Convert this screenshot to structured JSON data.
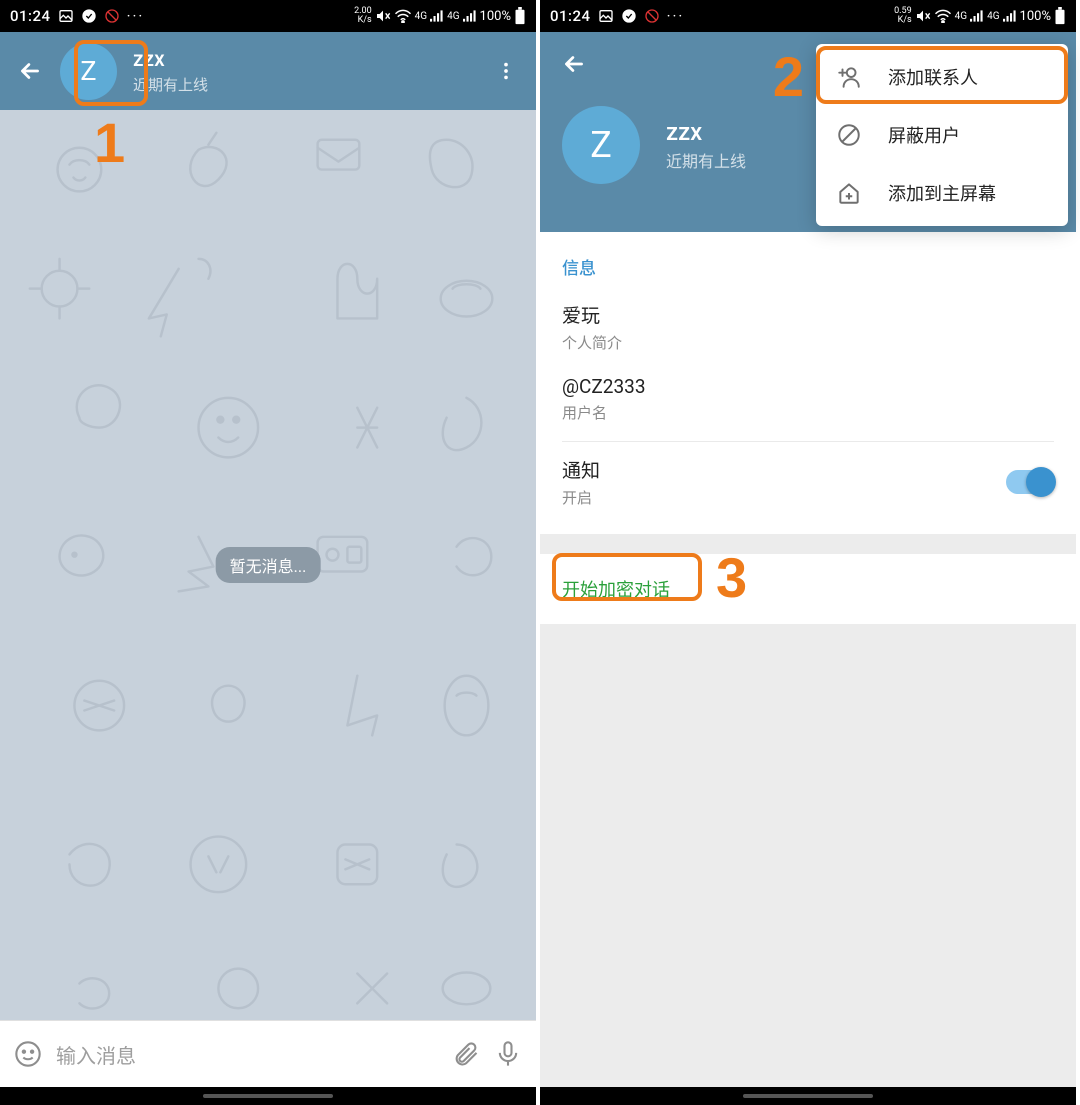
{
  "status": {
    "time": "01:24",
    "kbs_left": "2.00",
    "kbs_right": "0.59",
    "kbs_unit": "K/s",
    "net": "4G",
    "battery": "100%",
    "ellipsis": "···"
  },
  "left": {
    "contact": {
      "initial": "Z",
      "name": "zzx",
      "status": "近期有上线"
    },
    "empty_message": "暂无消息...",
    "input_placeholder": "输入消息"
  },
  "right": {
    "contact": {
      "initial": "Z",
      "name": "zzx",
      "status": "近期有上线"
    },
    "menu": {
      "add_contact": "添加联系人",
      "block_user": "屏蔽用户",
      "add_to_home": "添加到主屏幕"
    },
    "info": {
      "section_title": "信息",
      "bio_value": "爱玩",
      "bio_label": "个人简介",
      "username_value": "@CZ2333",
      "username_label": "用户名",
      "notifications_label": "通知",
      "notifications_value": "开启"
    },
    "action": {
      "start_secret_chat": "开始加密对话"
    }
  },
  "annotations": {
    "n1": "1",
    "n2": "2",
    "n3": "3"
  }
}
